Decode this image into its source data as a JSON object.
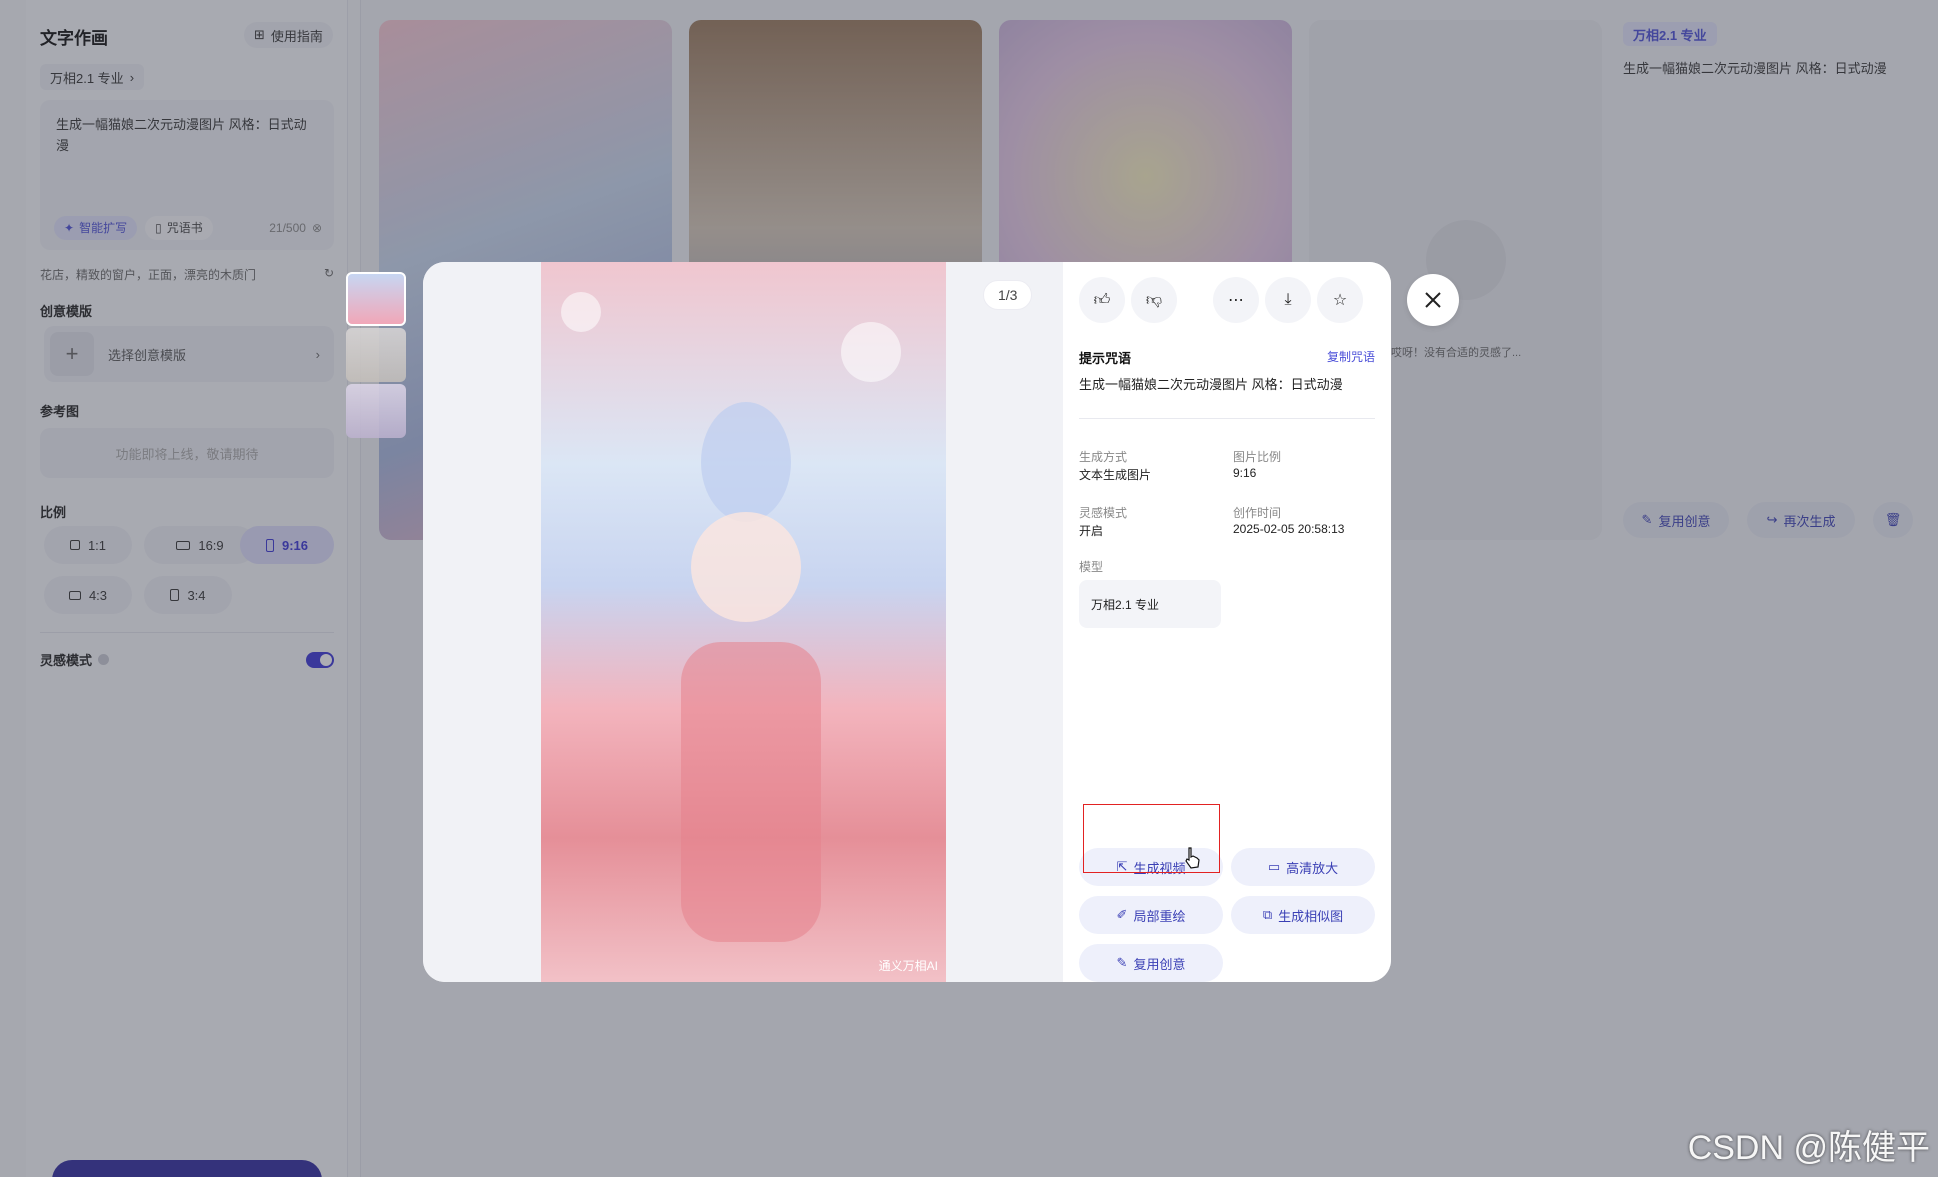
{
  "left_panel": {
    "title": "文字作画",
    "guide_label": "使用指南",
    "model_chip": "万相2.1 专业",
    "prompt_text": "生成一幅猫娘二次元动漫图片 风格：日式动漫",
    "smart_expand": "智能扩写",
    "spell_book": "咒语书",
    "counter_current": "21",
    "counter_max": "/500",
    "hint": "花店，精致的窗户，正面，漂亮的木质门",
    "template_label": "创意模版",
    "template_placeholder": "选择创意模版",
    "reference_label": "参考图",
    "reference_placeholder": "功能即将上线，敬请期待",
    "ratio_label": "比例",
    "ratios": [
      "1:1",
      "16:9",
      "9:16",
      "4:3",
      "3:4"
    ],
    "selected_ratio": "9:16",
    "inspire_label": "灵感模式",
    "inspire_on": true
  },
  "gallery": {
    "model_tag": "万相2.1 专业",
    "prompt": "生成一幅猫娘二次元动漫图片 风格：日式动漫",
    "empty_text": "哎呀！没有合适的灵感了...",
    "reuse_label": "复用创意",
    "regenerate_label": "再次生成"
  },
  "viewer": {
    "page_indicator": "1/3",
    "watermark": "通义万相AI",
    "prompt_heading": "提示咒语",
    "copy_prompt": "复制咒语",
    "prompt": "生成一幅猫娘二次元动漫图片 风格：日式动漫",
    "gen_method_label": "生成方式",
    "gen_method": "文本生成图片",
    "ratio_label": "图片比例",
    "ratio": "9:16",
    "inspire_label": "灵感模式",
    "inspire": "开启",
    "created_label": "创作时间",
    "created": "2025-02-05 20:58:13",
    "model_label": "模型",
    "model": "万相2.1 专业",
    "actions": {
      "gen_video": "生成视频",
      "hd_upscale": "高清放大",
      "inpaint": "局部重绘",
      "similar": "生成相似图",
      "reuse": "复用创意"
    }
  },
  "watermark_footer": "CSDN @陈健平",
  "colors": {
    "accent": "#4b4fd8",
    "highlight": "#e22222"
  }
}
